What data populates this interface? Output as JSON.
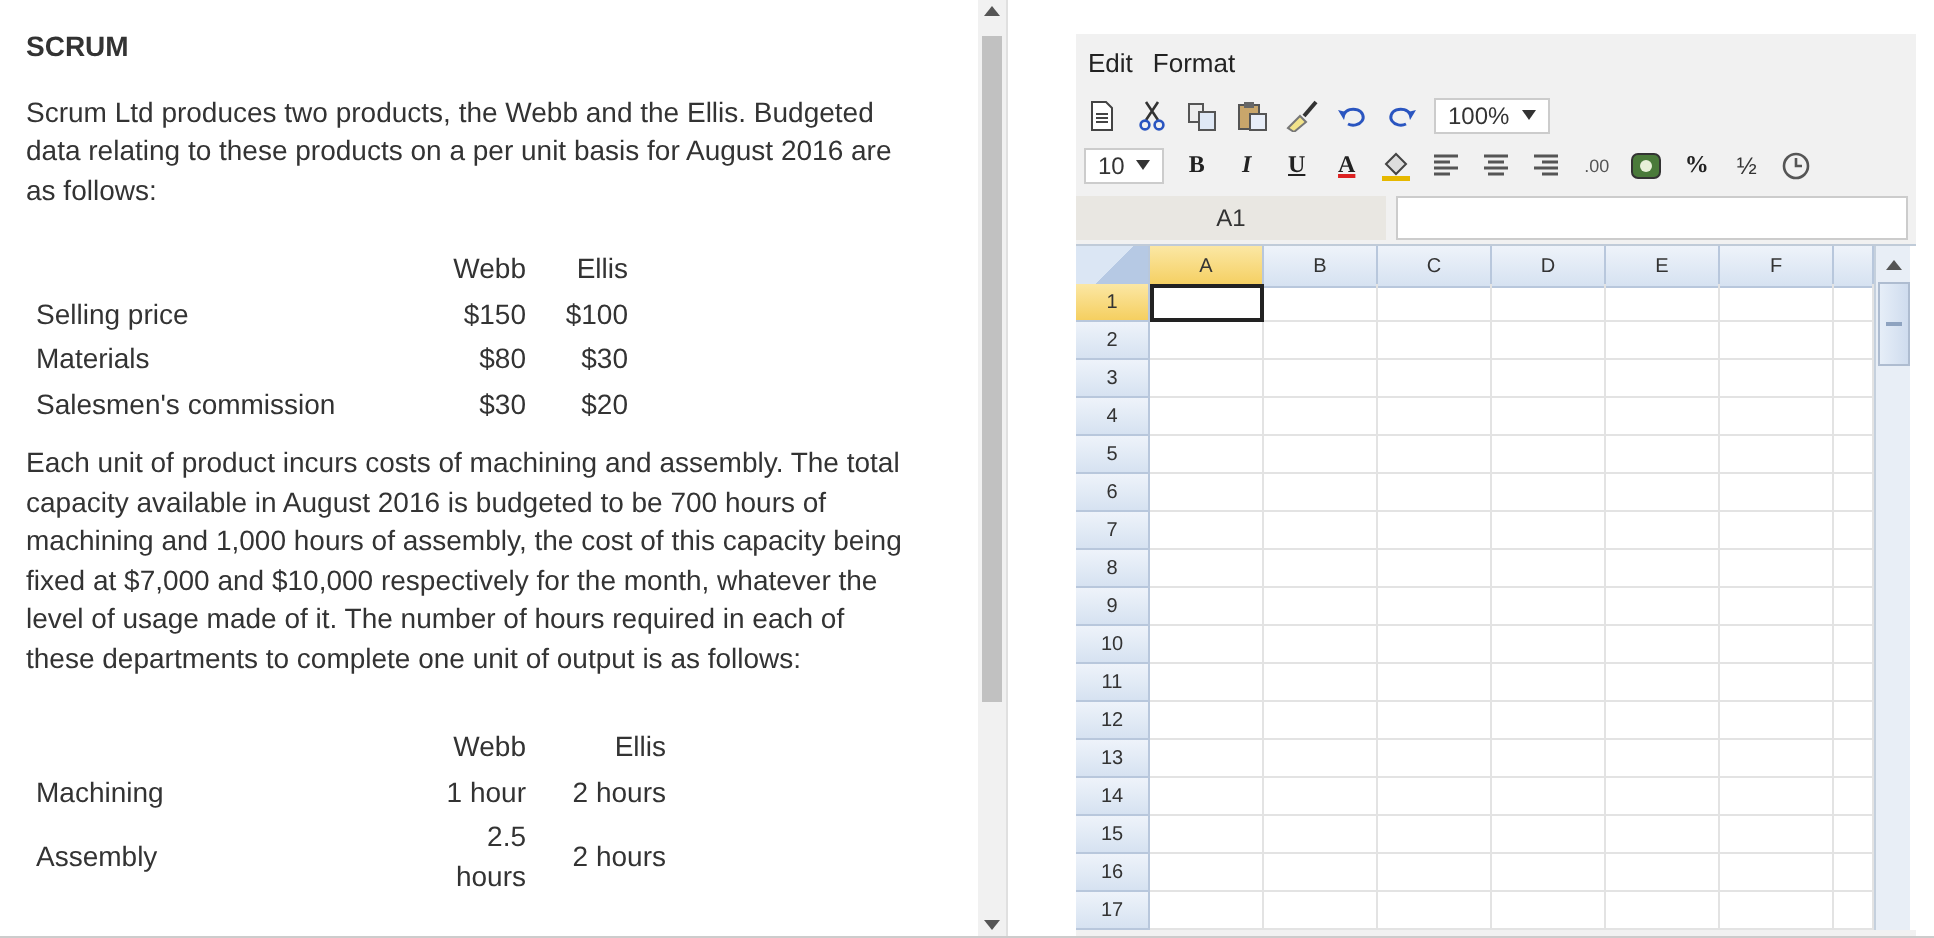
{
  "question": {
    "title": "SCRUM",
    "intro": "Scrum Ltd produces two products, the Webb and the Ellis. Budgeted data relating to these products on a per unit basis for August 2016 are as follows:",
    "table_1": {
      "columns": [
        "Webb",
        "Ellis"
      ],
      "rows": [
        {
          "label": "Selling price",
          "values": [
            "$150",
            "$100"
          ]
        },
        {
          "label": "Materials",
          "values": [
            "$80",
            "$30"
          ]
        },
        {
          "label": "Salesmen's commission",
          "values": [
            "$30",
            "$20"
          ]
        }
      ]
    },
    "body": "Each unit of product incurs costs of machining and assembly. The total capacity available in August 2016 is budgeted to be 700 hours of machining and 1,000 hours of assembly, the cost of this capacity being fixed at $7,000 and $10,000 respectively for the month, whatever the level of usage made of it. The number of hours required in each of these departments to complete one unit of output is as follows:",
    "table_2": {
      "columns": [
        "Webb",
        "Ellis"
      ],
      "rows": [
        {
          "label": "Machining",
          "values": [
            "1 hour",
            "2 hours"
          ]
        },
        {
          "label": "Assembly",
          "values": [
            "2.5 hours",
            "2 hours"
          ]
        }
      ]
    }
  },
  "spreadsheet": {
    "menu": [
      "Edit",
      "Format"
    ],
    "zoom": "100%",
    "font_size": "10",
    "toolbar_text": {
      "bold": "B",
      "italic": "I",
      "underline": "U",
      "text_color": "A",
      "decimals": ".00",
      "percent": "%",
      "fraction": "½"
    },
    "cell_name": "A1",
    "columns": [
      {
        "label": "A",
        "selected": true
      },
      {
        "label": "B",
        "selected": false
      },
      {
        "label": "C",
        "selected": false
      },
      {
        "label": "D",
        "selected": false
      },
      {
        "label": "E",
        "selected": false
      },
      {
        "label": "F",
        "selected": false
      }
    ],
    "rows": [
      {
        "label": "1",
        "selected": true
      },
      {
        "label": "2",
        "selected": false
      },
      {
        "label": "3",
        "selected": false
      },
      {
        "label": "4",
        "selected": false
      },
      {
        "label": "5",
        "selected": false
      },
      {
        "label": "6",
        "selected": false
      },
      {
        "label": "7",
        "selected": false
      },
      {
        "label": "8",
        "selected": false
      },
      {
        "label": "9",
        "selected": false
      },
      {
        "label": "10",
        "selected": false
      },
      {
        "label": "11",
        "selected": false
      },
      {
        "label": "12",
        "selected": false
      },
      {
        "label": "13",
        "selected": false
      },
      {
        "label": "14",
        "selected": false
      },
      {
        "label": "15",
        "selected": false
      },
      {
        "label": "16",
        "selected": false
      },
      {
        "label": "17",
        "selected": false
      }
    ]
  }
}
